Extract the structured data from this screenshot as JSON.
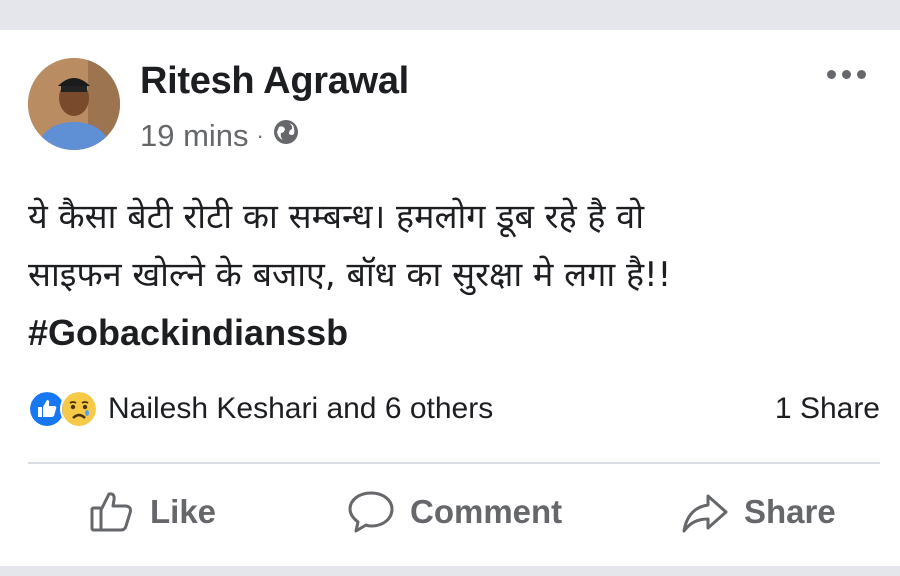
{
  "post": {
    "author": "Ritesh Agrawal",
    "timestamp": "19 mins",
    "separator": "·",
    "privacy_icon": "globe-icon",
    "text_lines": [
      "ये कैसा  बेटी रोटी का सम्बन्ध। हमलोग डूब रहे है वो",
      "साइफन खोल्ने के बजाए, बॉध का सुरक्षा मे लगा है!!"
    ],
    "hashtag": "#Gobackindianssb"
  },
  "engagement": {
    "reaction_icons": [
      "like-icon",
      "sad-icon"
    ],
    "reacted_by": "Nailesh Keshari and 6 others",
    "shares": "1 Share"
  },
  "actions": {
    "like": "Like",
    "comment": "Comment",
    "share": "Share"
  },
  "colors": {
    "like_blue": "#1877f2",
    "text": "#1c1e21",
    "secondary": "#65676b"
  }
}
